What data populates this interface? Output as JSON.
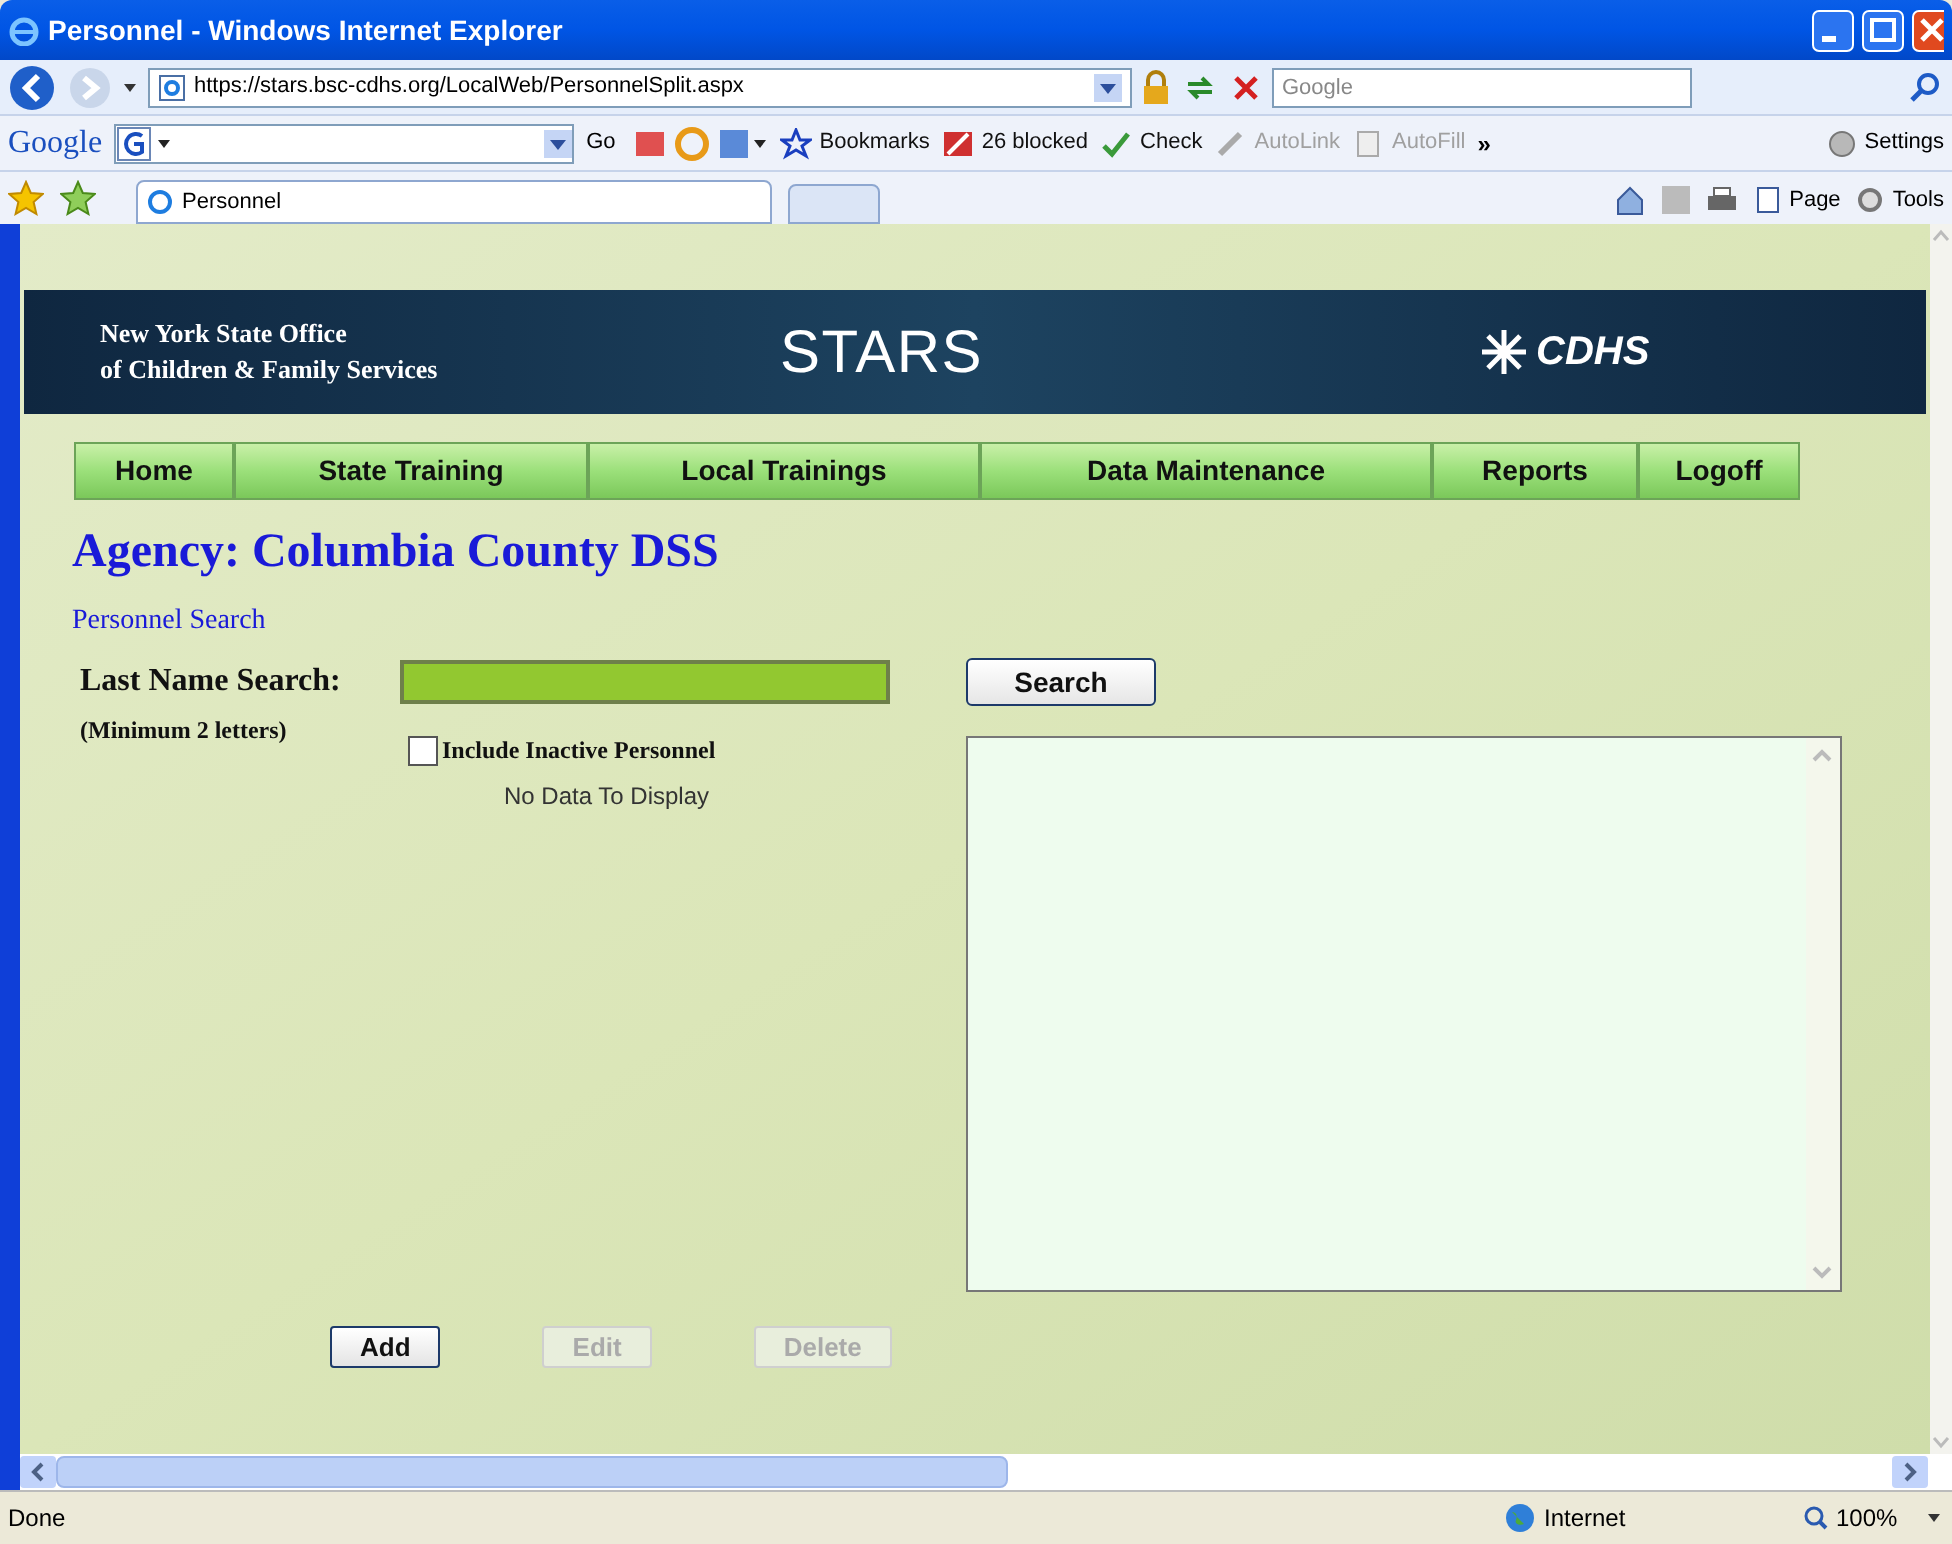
{
  "window": {
    "title": "Personnel - Windows Internet Explorer"
  },
  "address_bar": {
    "url": "https://stars.bsc-cdhs.org/LocalWeb/PersonnelSplit.aspx",
    "search_placeholder": "Google"
  },
  "google_toolbar": {
    "logo": "Google",
    "go": "Go",
    "items": [
      {
        "label": "Bookmarks",
        "kind": "bookmarks",
        "disabled": false
      },
      {
        "label": "26 blocked",
        "kind": "blocked",
        "disabled": false
      },
      {
        "label": "Check",
        "kind": "check",
        "disabled": false
      },
      {
        "label": "AutoLink",
        "kind": "autolink",
        "disabled": true
      },
      {
        "label": "AutoFill",
        "kind": "autofill",
        "disabled": true
      }
    ],
    "more": "»",
    "settings": "Settings"
  },
  "tabs": [
    {
      "label": "Personnel",
      "selected": true
    }
  ],
  "command_bar": [
    {
      "label": "Page"
    },
    {
      "label": "Tools"
    }
  ],
  "banner": {
    "org_line_1": "New York State Office",
    "org_line_2": "of Children & Family Services",
    "app_name": "STARS",
    "partner": "CDHS"
  },
  "nav": [
    {
      "label": "Home"
    },
    {
      "label": "State Training"
    },
    {
      "label": "Local Trainings"
    },
    {
      "label": "Data Maintenance"
    },
    {
      "label": "Reports"
    },
    {
      "label": "Logoff"
    }
  ],
  "heading": "Agency: Columbia County DSS",
  "breadcrumb": "Personnel Search",
  "search_form": {
    "label": "Last Name Search:",
    "hint": "(Minimum 2 letters)",
    "button": "Search",
    "include_inactive": {
      "label": "Include Inactive Personnel",
      "checked": false
    },
    "empty_message": "No Data To Display"
  },
  "actions": [
    {
      "label": "Add",
      "disabled": false
    },
    {
      "label": "Edit",
      "disabled": true
    },
    {
      "label": "Delete",
      "disabled": true
    }
  ],
  "status_bar": {
    "text": "Done",
    "zone": "Internet",
    "zoom": "100%"
  }
}
